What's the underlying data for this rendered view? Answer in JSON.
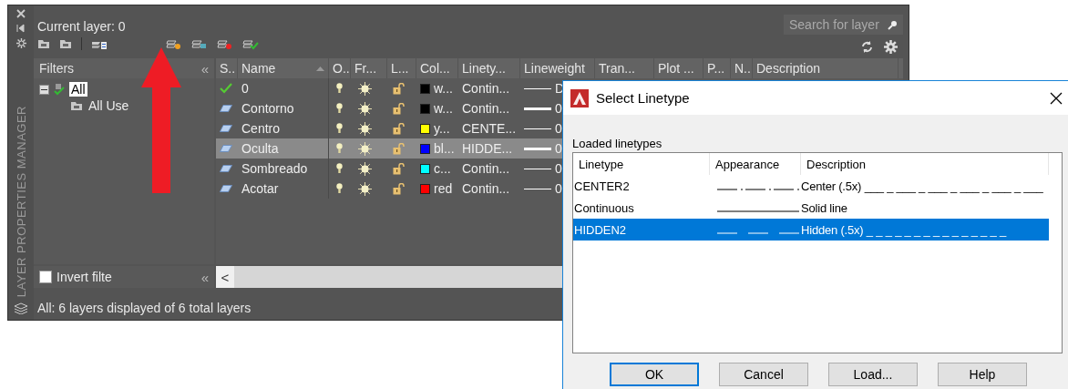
{
  "side_strip": {
    "title": "LAYER PROPERTIES MANAGER"
  },
  "header": {
    "current_layer": "Current layer: 0",
    "search": {
      "placeholder": "Search for layer"
    }
  },
  "filters": {
    "title": "Filters",
    "collapse": "«",
    "tree": [
      {
        "label": "All",
        "selected": true,
        "expanded": true,
        "children": [
          {
            "label": "All Use",
            "selected": false
          }
        ]
      }
    ],
    "invert": {
      "label": "Invert filte",
      "checked": false,
      "collapse": "«"
    }
  },
  "layers": {
    "columns": [
      "S..",
      "Name",
      "O..",
      "Fr...",
      "L...",
      "Col...",
      "Linety...",
      "Lineweight",
      "Tran...",
      "Plot ...",
      "P...",
      "N..",
      "Description"
    ],
    "rows": [
      {
        "kind": "current",
        "name": "0",
        "selected": false,
        "color": "#000000",
        "color_name": "w...",
        "linetype": "Contin...",
        "heavy": false,
        "lineweight": "D"
      },
      {
        "kind": "layer",
        "name": "Contorno",
        "selected": false,
        "color": "#000000",
        "color_name": "w...",
        "linetype": "Contin...",
        "heavy": true,
        "lineweight": "0"
      },
      {
        "kind": "layer",
        "name": "Centro",
        "selected": false,
        "color": "#ffff00",
        "color_name": "y...",
        "linetype": "CENTE...",
        "heavy": false,
        "lineweight": "0"
      },
      {
        "kind": "layer",
        "name": "Oculta",
        "selected": true,
        "color": "#0000ff",
        "color_name": "bl...",
        "linetype": "HIDDE...",
        "heavy": true,
        "lineweight": "0"
      },
      {
        "kind": "layer",
        "name": "Sombreado",
        "selected": false,
        "color": "#00ffff",
        "color_name": "c...",
        "linetype": "Contin...",
        "heavy": false,
        "lineweight": "0"
      },
      {
        "kind": "layer",
        "name": "Acotar",
        "selected": false,
        "color": "#ff0000",
        "color_name": "red",
        "linetype": "Contin...",
        "heavy": false,
        "lineweight": "0"
      }
    ],
    "scroll_left": "<"
  },
  "status_bar": "All: 6 layers displayed of 6 total layers",
  "dialog": {
    "title": "Select Linetype",
    "list_label": "Loaded linetypes",
    "columns": [
      "Linetype",
      "Appearance",
      "Description"
    ],
    "rows": [
      {
        "name": "CENTER2",
        "kind": "center",
        "description": "Center (.5x) ___ _ ___ _ ___ _ ___ _ ___ _ ___",
        "selected": false
      },
      {
        "name": "Continuous",
        "kind": "continuous",
        "description": "Solid line",
        "selected": false
      },
      {
        "name": "HIDDEN2",
        "kind": "hidden",
        "description": "Hidden (.5x) _ _ _ _ _ _ _ _ _ _ _ _ _ _ _",
        "selected": true
      }
    ],
    "buttons": [
      {
        "label": "OK",
        "default": true
      },
      {
        "label": "Cancel",
        "default": false
      },
      {
        "label": "Load...",
        "default": false
      },
      {
        "label": "Help",
        "default": false
      }
    ]
  }
}
